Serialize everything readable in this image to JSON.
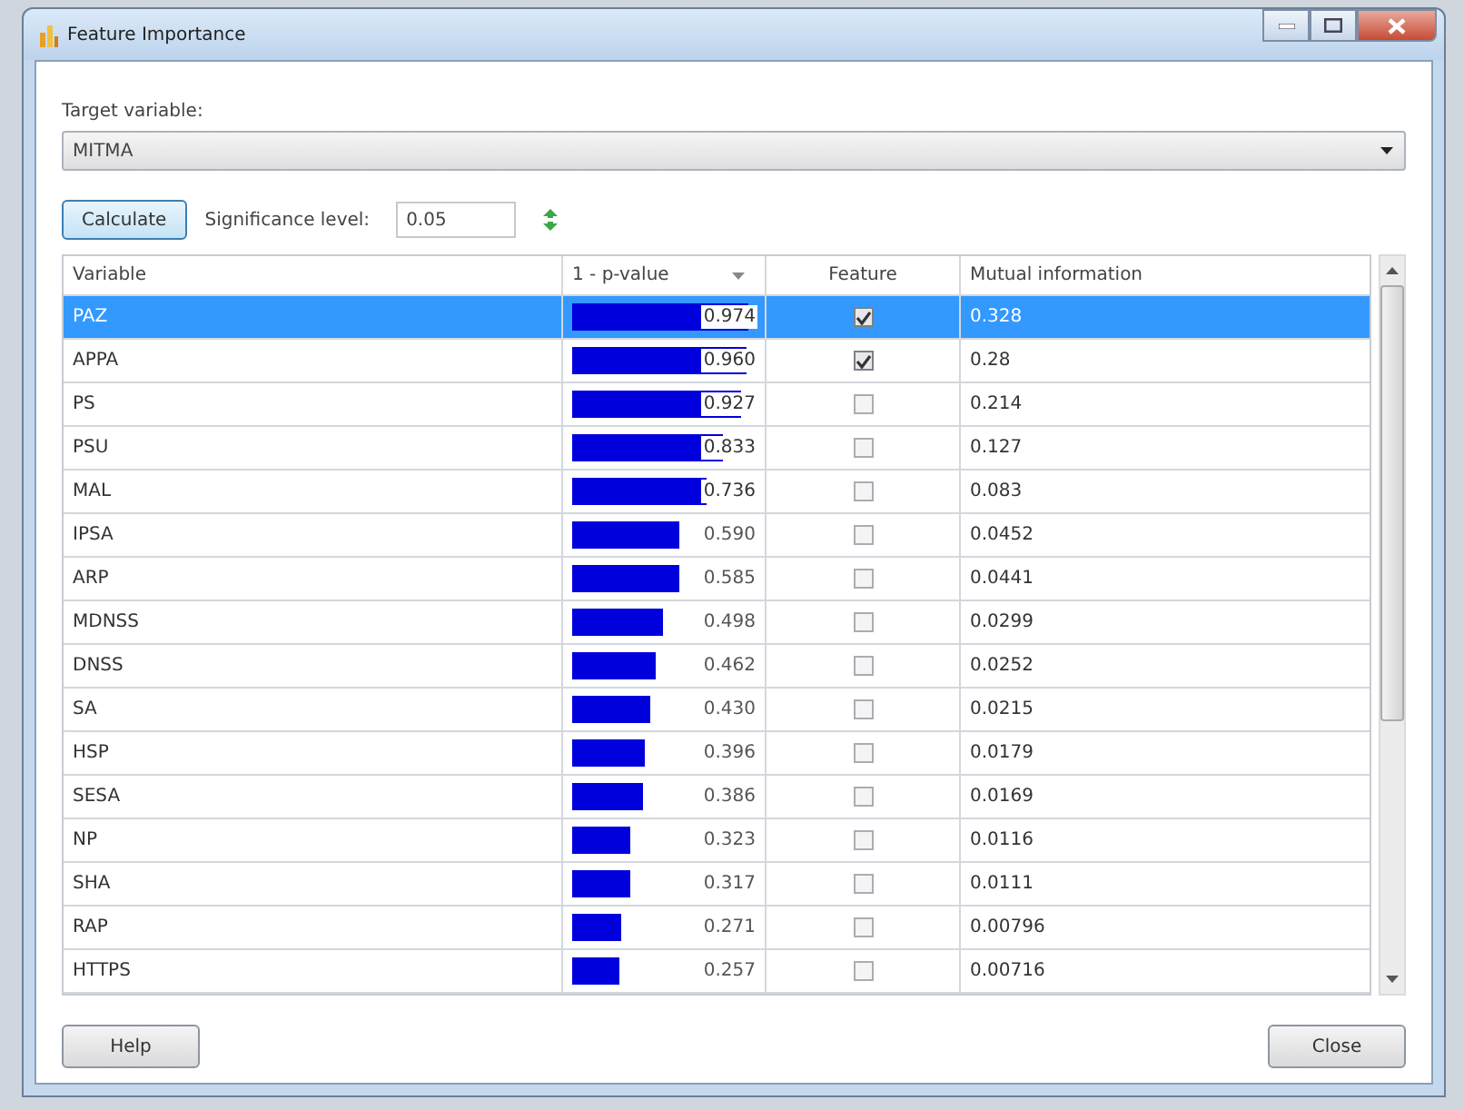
{
  "window": {
    "title": "Feature Importance"
  },
  "target": {
    "label": "Target variable:",
    "value": "MITMA"
  },
  "calculate_button": "Calculate",
  "significance": {
    "label": "Significance level:",
    "value": "0.05"
  },
  "table": {
    "columns": [
      "Variable",
      "1 - p-value",
      "Feature",
      "Mutual information"
    ],
    "rows": [
      {
        "variable": "PAZ",
        "p_value": "0.974",
        "level": 0.974,
        "feature": true,
        "mutual_information": "0.328",
        "selected": true
      },
      {
        "variable": "APPA",
        "p_value": "0.960",
        "level": 0.96,
        "feature": true,
        "mutual_information": "0.28",
        "selected": false
      },
      {
        "variable": "PS",
        "p_value": "0.927",
        "level": 0.927,
        "feature": false,
        "mutual_information": "0.214",
        "selected": false
      },
      {
        "variable": "PSU",
        "p_value": "0.833",
        "level": 0.833,
        "feature": false,
        "mutual_information": "0.127",
        "selected": false
      },
      {
        "variable": "MAL",
        "p_value": "0.736",
        "level": 0.736,
        "feature": false,
        "mutual_information": "0.083",
        "selected": false
      },
      {
        "variable": "IPSA",
        "p_value": "0.590",
        "level": 0.59,
        "feature": false,
        "mutual_information": "0.0452",
        "selected": false
      },
      {
        "variable": "ARP",
        "p_value": "0.585",
        "level": 0.585,
        "feature": false,
        "mutual_information": "0.0441",
        "selected": false
      },
      {
        "variable": "MDNSS",
        "p_value": "0.498",
        "level": 0.498,
        "feature": false,
        "mutual_information": "0.0299",
        "selected": false
      },
      {
        "variable": "DNSS",
        "p_value": "0.462",
        "level": 0.462,
        "feature": false,
        "mutual_information": "0.0252",
        "selected": false
      },
      {
        "variable": "SA",
        "p_value": "0.430",
        "level": 0.43,
        "feature": false,
        "mutual_information": "0.0215",
        "selected": false
      },
      {
        "variable": "HSP",
        "p_value": "0.396",
        "level": 0.396,
        "feature": false,
        "mutual_information": "0.0179",
        "selected": false
      },
      {
        "variable": "SESA",
        "p_value": "0.386",
        "level": 0.386,
        "feature": false,
        "mutual_information": "0.0169",
        "selected": false
      },
      {
        "variable": "NP",
        "p_value": "0.323",
        "level": 0.323,
        "feature": false,
        "mutual_information": "0.0116",
        "selected": false
      },
      {
        "variable": "SHA",
        "p_value": "0.317",
        "level": 0.317,
        "feature": false,
        "mutual_information": "0.0111",
        "selected": false
      },
      {
        "variable": "RAP",
        "p_value": "0.271",
        "level": 0.271,
        "feature": false,
        "mutual_information": "0.00796",
        "selected": false
      },
      {
        "variable": "HTTPS",
        "p_value": "0.257",
        "level": 0.257,
        "feature": false,
        "mutual_information": "0.00716",
        "selected": false
      }
    ]
  },
  "buttons": [
    "Help",
    "Close"
  ]
}
